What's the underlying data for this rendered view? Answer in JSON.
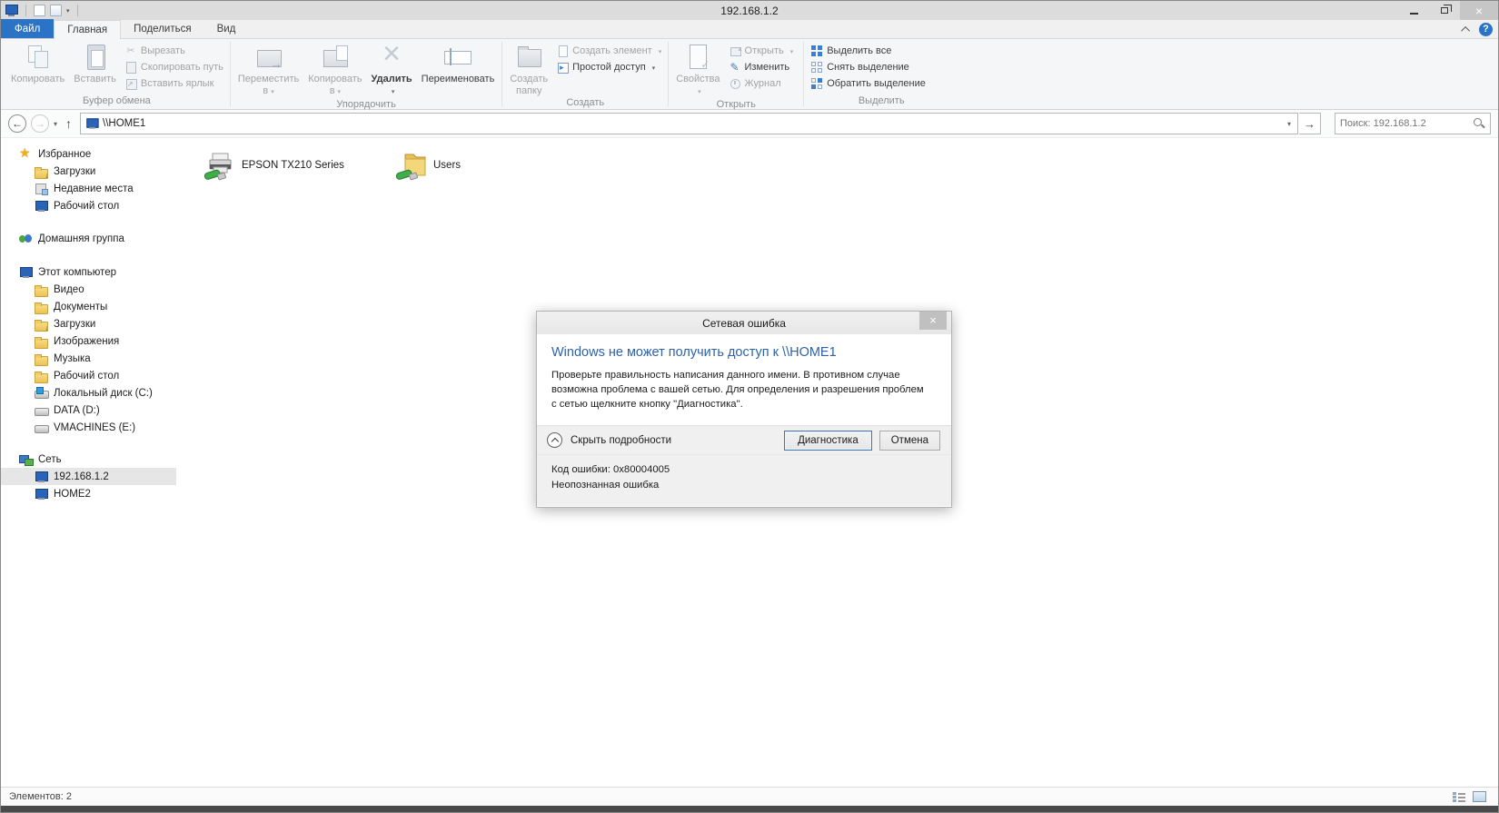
{
  "colors": {
    "accent_blue": "#2a73c5",
    "dialog_heading_blue": "#2e62a8",
    "folder_yellow": "#f0c75a",
    "network_cable_green": "#3fae49"
  },
  "titlebar": {
    "title": "192.168.1.2"
  },
  "tabs": {
    "file": "Файл",
    "home": "Главная",
    "share": "Поделиться",
    "view": "Вид"
  },
  "ribbon": {
    "clipboard": {
      "group": "Буфер обмена",
      "copy": "Копировать",
      "paste": "Вставить",
      "cut": "Вырезать",
      "copy_path": "Скопировать путь",
      "paste_shortcut": "Вставить ярлык"
    },
    "organize": {
      "group": "Упорядочить",
      "move_to_line1": "Переместить",
      "move_to_line2": "в",
      "copy_to_line1": "Копировать",
      "copy_to_line2": "в",
      "delete": "Удалить",
      "rename": "Переименовать"
    },
    "create": {
      "group": "Создать",
      "new_folder_line1": "Создать",
      "new_folder_line2": "папку",
      "new_item": "Создать элемент",
      "easy_access": "Простой доступ"
    },
    "open": {
      "group": "Открыть",
      "properties": "Свойства",
      "open": "Открыть",
      "edit": "Изменить",
      "history": "Журнал"
    },
    "select": {
      "group": "Выделить",
      "select_all": "Выделить все",
      "select_none": "Снять выделение",
      "invert": "Обратить выделение"
    }
  },
  "address": {
    "path": "\\\\HOME1",
    "search_placeholder": "Поиск: 192.168.1.2"
  },
  "sidebar": {
    "favorites": {
      "label": "Избранное",
      "items": [
        "Загрузки",
        "Недавние места",
        "Рабочий стол"
      ]
    },
    "homegroup": {
      "label": "Домашняя группа"
    },
    "this_pc": {
      "label": "Этот компьютер",
      "items": [
        "Видео",
        "Документы",
        "Загрузки",
        "Изображения",
        "Музыка",
        "Рабочий стол",
        "Локальный диск (C:)",
        "DATA (D:)",
        "VMACHINES (E:)"
      ]
    },
    "network": {
      "label": "Сеть",
      "items": [
        "192.168.1.2",
        "HOME2"
      ],
      "selected_item": "192.168.1.2"
    }
  },
  "content": {
    "items": [
      {
        "label": "EPSON TX210 Series"
      },
      {
        "label": "Users"
      }
    ]
  },
  "dialog": {
    "title": "Сетевая ошибка",
    "heading": "Windows не может получить доступ к \\\\HOME1",
    "body": "Проверьте правильность написания данного имени. В противном случае возможна проблема с вашей сетью. Для определения и разрешения проблем с сетью щелкните кнопку \"Диагностика\".",
    "hide_details": "Скрыть подробности",
    "diagnose_button": "Диагностика",
    "cancel_button": "Отмена",
    "error_code": "Код ошибки: 0x80004005",
    "error_text": "Неопознанная ошибка",
    "close_glyph": "×"
  },
  "statusbar": {
    "items_count": "Элементов: 2"
  },
  "window_controls": {
    "close_glyph": "×"
  }
}
